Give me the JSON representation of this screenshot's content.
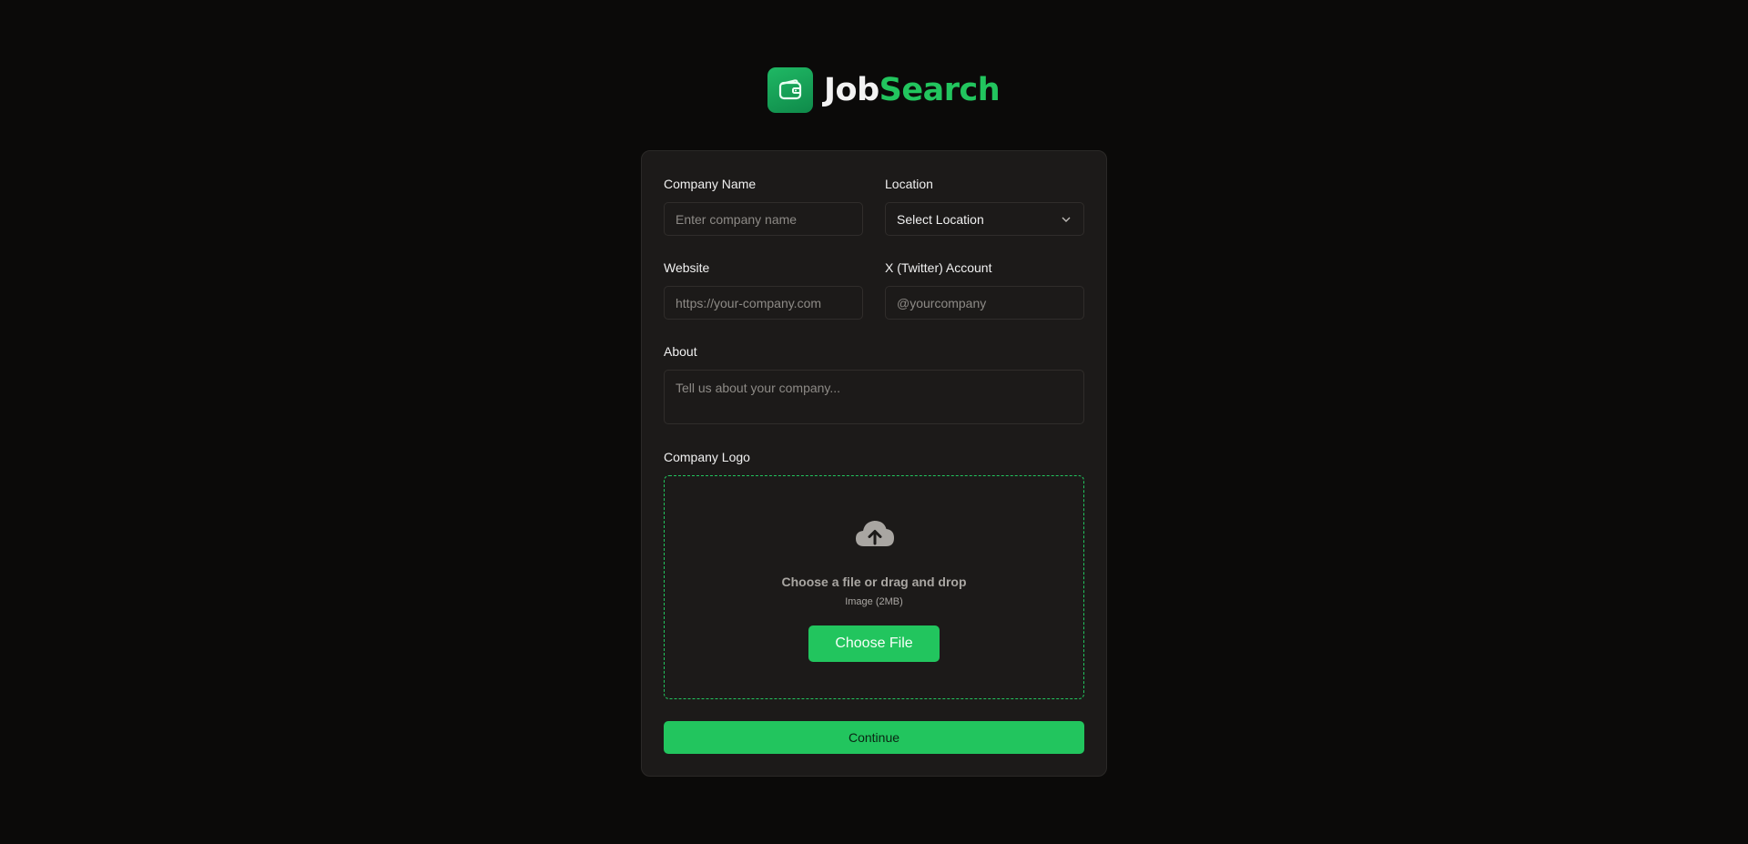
{
  "brand": {
    "name_part1": "Job",
    "name_part2": "Search",
    "logo_icon": "wallet-icon"
  },
  "colors": {
    "accent": "#22c55e",
    "background": "#0b0a09",
    "card": "#1c1a19"
  },
  "form": {
    "company_name": {
      "label": "Company Name",
      "placeholder": "Enter company name"
    },
    "location": {
      "label": "Location",
      "value": "Select Location",
      "icon": "chevron-down-icon"
    },
    "website": {
      "label": "Website",
      "placeholder": "https://your-company.com"
    },
    "twitter": {
      "label": "X (Twitter) Account",
      "placeholder": "@yourcompany"
    },
    "about": {
      "label": "About",
      "placeholder": "Tell us about your company..."
    },
    "logo": {
      "label": "Company Logo",
      "icon": "cloud-upload-icon",
      "title": "Choose a file or drag and drop",
      "subtitle": "Image (2MB)",
      "button": "Choose File"
    },
    "continue_label": "Continue"
  }
}
